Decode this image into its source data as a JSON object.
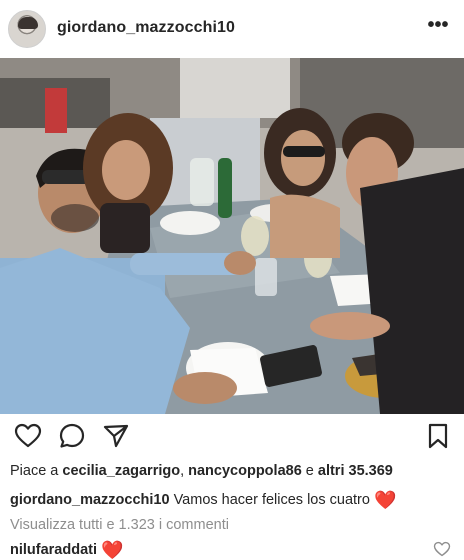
{
  "post": {
    "username": "giordano_mazzocchi10",
    "more_glyph": "•••"
  },
  "likes": {
    "prefix": "Piace a ",
    "user1": "cecilia_zagarrigo",
    "sep": ", ",
    "user2": "nancycoppola86",
    "mid": " e ",
    "others": "altri 35.369"
  },
  "caption": {
    "user": "giordano_mazzocchi10",
    "text": " Vamos hacer felices los cuatro ",
    "emoji": "❤️"
  },
  "comments_link": "Visualizza tutti e 1.323 i commenti",
  "comment": {
    "user": "nilufaraddati",
    "emoji": "❤️"
  },
  "icons": [
    "heart-icon",
    "comment-icon",
    "share-icon",
    "bookmark-icon",
    "more-icon"
  ],
  "colors": {
    "text": "#262626",
    "muted": "#8e8e8e",
    "heart": "#e0302c"
  }
}
